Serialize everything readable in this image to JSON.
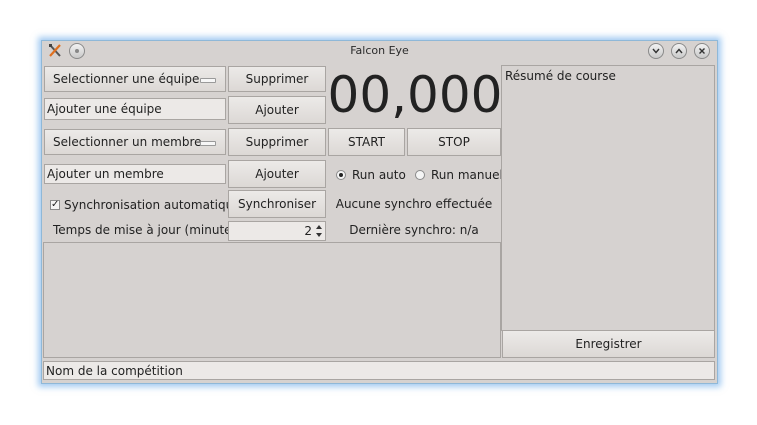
{
  "window": {
    "title": "Falcon Eye"
  },
  "teams": {
    "select_label": "Selectionner une équipe",
    "delete_label": "Supprimer",
    "add_placeholder": "Ajouter une équipe",
    "add_label": "Ajouter"
  },
  "members": {
    "select_label": "Selectionner un membre",
    "delete_label": "Supprimer",
    "add_placeholder": "Ajouter un membre",
    "add_label": "Ajouter"
  },
  "timer": {
    "display": "00,000",
    "start_label": "START",
    "stop_label": "STOP"
  },
  "run_mode": {
    "auto_label": "Run auto",
    "manual_label": "Run manuel",
    "selected": "auto"
  },
  "sync": {
    "auto_label": "Synchronisation automatique",
    "auto_checked": true,
    "button_label": "Synchroniser",
    "status": "Aucune synchro effectuée",
    "interval_label": "Temps de mise à jour (minutes)",
    "interval_value": "2",
    "last_sync": "Dernière synchro: n/a"
  },
  "summary": {
    "title": "Résumé de course",
    "save_label": "Enregistrer"
  },
  "competition": {
    "name_placeholder": "Nom de la compétition"
  },
  "icons": {
    "app": "tools-icon",
    "menu": "circle-menu-icon",
    "minimize": "chevron-down-icon",
    "maximize": "chevron-up-icon",
    "close": "close-icon"
  }
}
